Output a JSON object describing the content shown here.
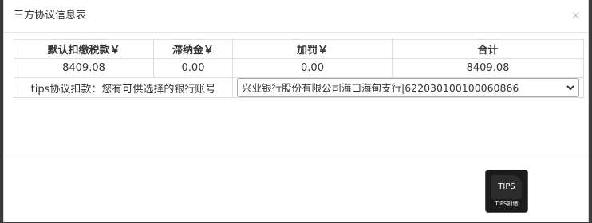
{
  "dialog": {
    "title": "三方协议信息表",
    "close_symbol": "×"
  },
  "table": {
    "headers": [
      "默认扣缴税款￥",
      "滞纳金￥",
      "加罚￥",
      "合计"
    ],
    "row": [
      "8409.08",
      "0.00",
      "0.00",
      "8409.08"
    ]
  },
  "tips": {
    "label": "tips协议扣款：您有可供选择的银行账号",
    "label_color": "#f0a65a",
    "selected_account": "兴业银行股份有限公司海口海甸支行|622030100100060866"
  },
  "logo": {
    "badge_text": "TIPS",
    "caption": "TIPS扣缴"
  }
}
